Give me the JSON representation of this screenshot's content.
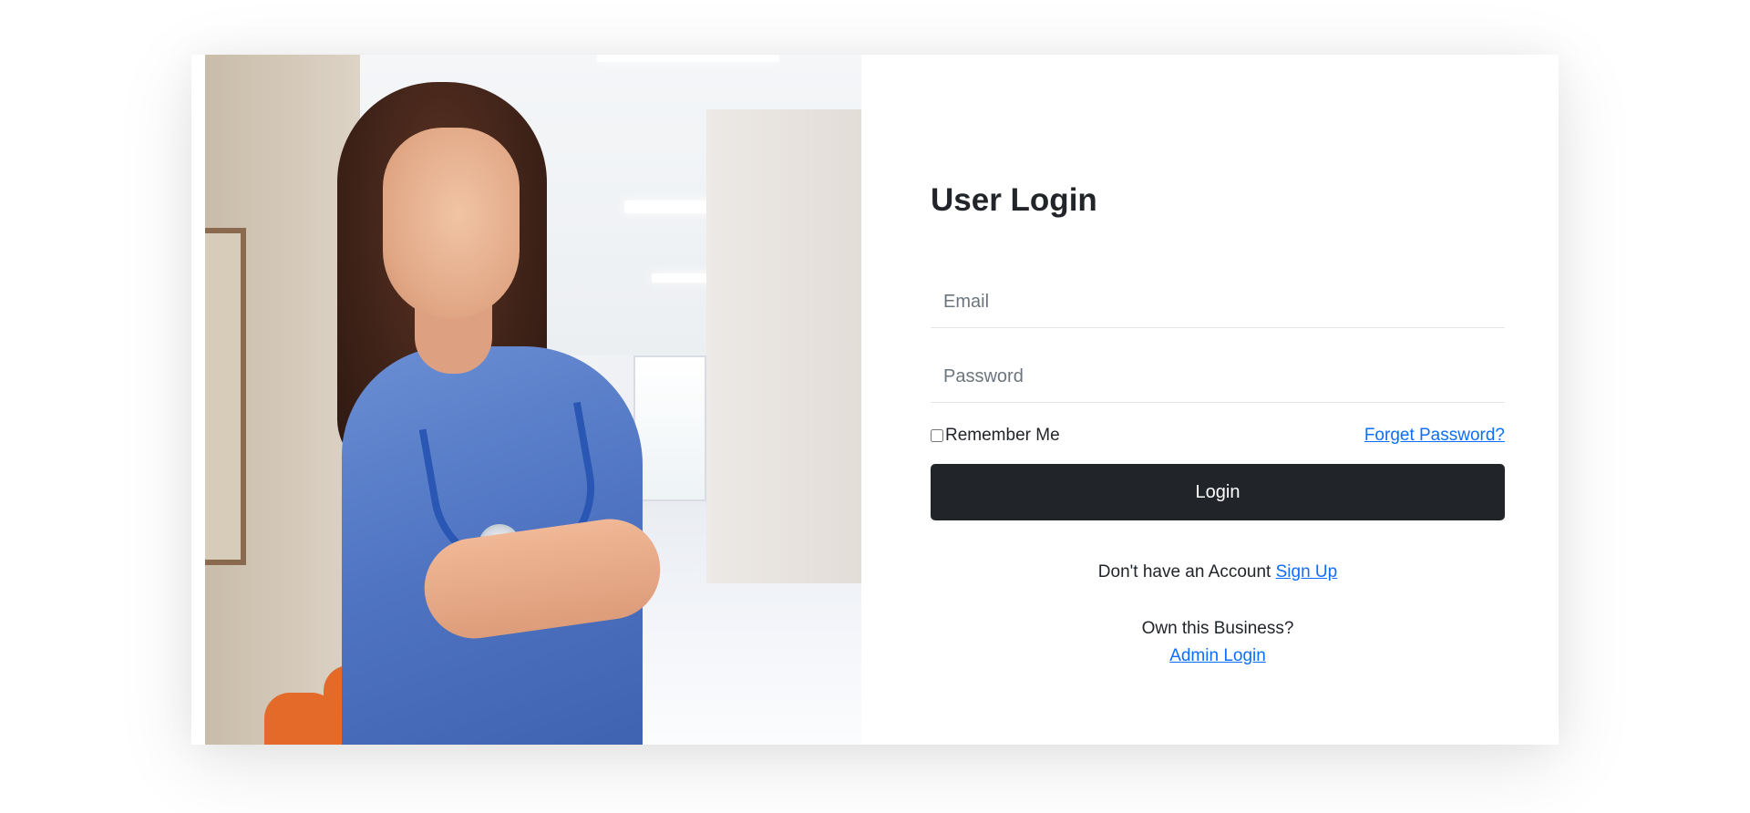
{
  "login": {
    "title": "User Login",
    "email_placeholder": "Email",
    "password_placeholder": "Password",
    "remember_label": "Remember Me",
    "forgot_link": "Forget Password?",
    "login_button": "Login",
    "signup_prompt": "Don't have an Account",
    "signup_link": "Sign Up",
    "owner_prompt": "Own this Business?",
    "admin_link": "Admin Login"
  },
  "colors": {
    "button_bg": "#212529",
    "link": "#0d6efd",
    "scrubs": "#4f74c2"
  },
  "image": {
    "icon": "nurse-photo"
  }
}
